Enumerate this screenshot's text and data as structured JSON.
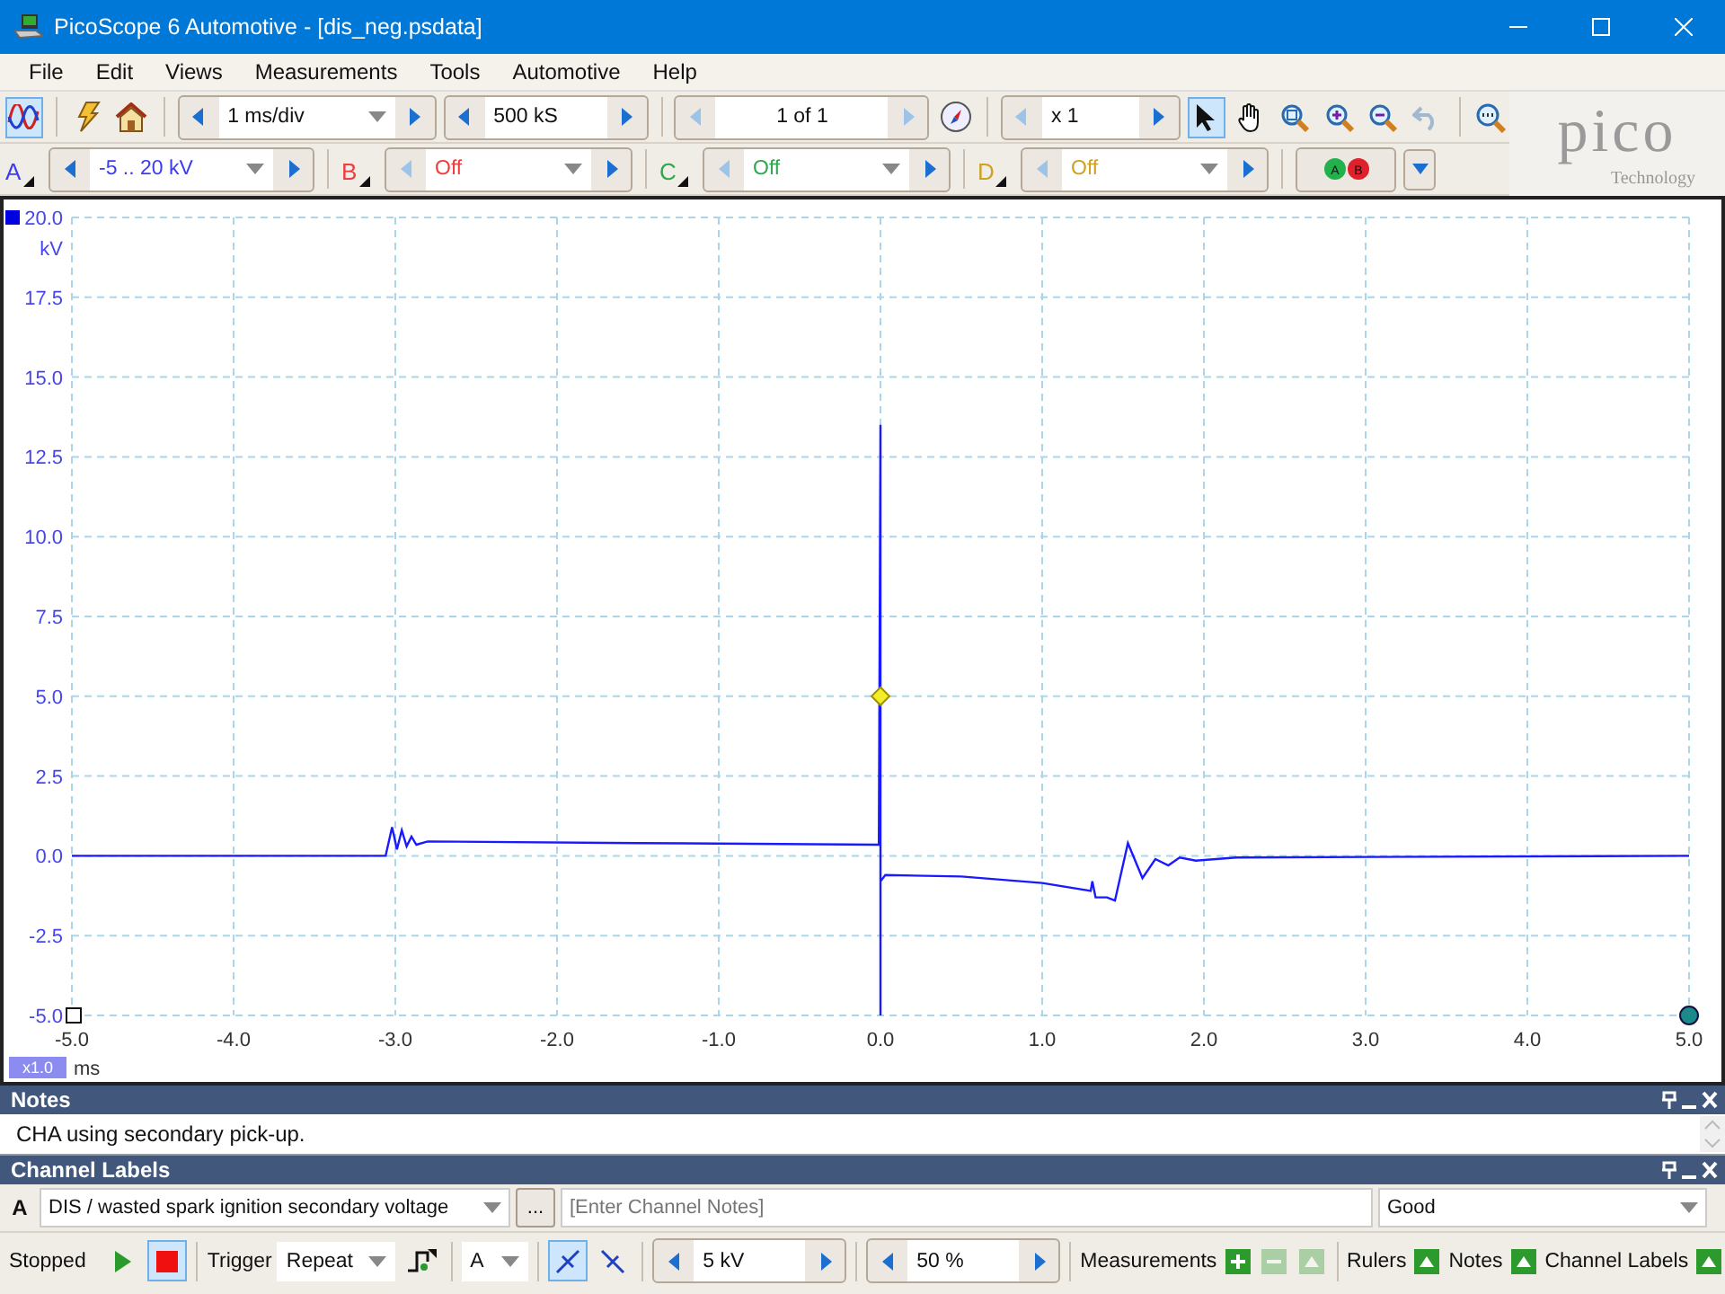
{
  "window": {
    "title": "PicoScope 6 Automotive - [dis_neg.psdata]"
  },
  "menu": [
    "File",
    "Edit",
    "Views",
    "Measurements",
    "Tools",
    "Automotive",
    "Help"
  ],
  "toolbar": {
    "timebase": "1 ms/div",
    "samples": "500 kS",
    "buffer": "1 of 1",
    "zoom": "x 1",
    "tools": [
      {
        "kind": "pointer",
        "selected": true,
        "disabled": false
      },
      {
        "kind": "hand",
        "selected": false,
        "disabled": false
      },
      {
        "kind": "zoom-box",
        "selected": false,
        "disabled": false
      },
      {
        "kind": "zoom-in",
        "selected": false,
        "disabled": false
      },
      {
        "kind": "zoom-out",
        "selected": false,
        "disabled": false
      },
      {
        "kind": "undo",
        "selected": false,
        "disabled": true
      }
    ]
  },
  "logo": {
    "name": "pico",
    "tagline": "Technology"
  },
  "channels": [
    {
      "letter": "A",
      "range": "-5 .. 20 kV",
      "color": "#3c3cf0",
      "enabled": true
    },
    {
      "letter": "B",
      "range": "Off",
      "color": "#f03c3c",
      "enabled": false
    },
    {
      "letter": "C",
      "range": "Off",
      "color": "#2fa84f",
      "enabled": false
    },
    {
      "letter": "D",
      "range": "Off",
      "color": "#d0a020",
      "enabled": false
    }
  ],
  "channel_dots": [
    {
      "label": "A",
      "color": "#22b14c"
    },
    {
      "label": "B",
      "color": "#e0202a"
    }
  ],
  "scope": {
    "zoom_badge": "x1.0",
    "chart_data": {
      "type": "line",
      "grid": true,
      "xlabel": "ms",
      "ylabel": "kV",
      "xlim": [
        -5,
        5
      ],
      "ylim": [
        -5,
        20
      ],
      "xticks": [
        {
          "value": -5,
          "label": "-5.0"
        },
        {
          "value": -4,
          "label": "-4.0"
        },
        {
          "value": -3,
          "label": "-3.0"
        },
        {
          "value": -2,
          "label": "-2.0"
        },
        {
          "value": -1,
          "label": "-1.0"
        },
        {
          "value": 0,
          "label": "0.0"
        },
        {
          "value": 1,
          "label": "1.0"
        },
        {
          "value": 2,
          "label": "2.0"
        },
        {
          "value": 3,
          "label": "3.0"
        },
        {
          "value": 4,
          "label": "4.0"
        },
        {
          "value": 5,
          "label": "5.0"
        }
      ],
      "yticks": [
        {
          "value": -5,
          "label": "-5.0"
        },
        {
          "value": -2.5,
          "label": "-2.5"
        },
        {
          "value": 0,
          "label": "0.0"
        },
        {
          "value": 2.5,
          "label": "2.5"
        },
        {
          "value": 5,
          "label": "5.0"
        },
        {
          "value": 7.5,
          "label": "7.5"
        },
        {
          "value": 10,
          "label": "10.0"
        },
        {
          "value": 12.5,
          "label": "12.5"
        },
        {
          "value": 15,
          "label": "15.0"
        },
        {
          "value": 17.5,
          "label": "17.5"
        },
        {
          "value": 20,
          "label": "20.0"
        }
      ],
      "x": [
        -5,
        -3.06,
        -3.02,
        -2.99,
        -2.96,
        -2.93,
        -2.9,
        -2.87,
        -2.8,
        -1.5,
        -0.01,
        0,
        0,
        0,
        0.03,
        0.5,
        1.0,
        1.3,
        1.31,
        1.33,
        1.4,
        1.45,
        1.53,
        1.62,
        1.7,
        1.78,
        1.85,
        1.95,
        2.2,
        5
      ],
      "series": [
        {
          "color": "#1a1aff",
          "values": [
            0,
            0,
            0.9,
            0.2,
            0.8,
            0.3,
            0.6,
            0.35,
            0.45,
            0.4,
            0.35,
            13.5,
            -5,
            -0.8,
            -0.6,
            -0.65,
            -0.85,
            -1.1,
            -0.8,
            -1.3,
            -1.3,
            -1.4,
            0.4,
            -0.7,
            -0.1,
            -0.3,
            -0.05,
            -0.15,
            -0.05,
            0
          ]
        }
      ]
    }
  },
  "notes": {
    "title": "Notes",
    "text": "CHA using secondary pick-up."
  },
  "channel_labels": {
    "title": "Channel Labels",
    "channel": "A",
    "label": "DIS / wasted spark ignition secondary voltage",
    "more": "...",
    "notes_placeholder": "[Enter Channel Notes]",
    "quality": "Good"
  },
  "status_bar": {
    "state": "Stopped",
    "running": false,
    "trigger_label": "Trigger",
    "trigger_mode": "Repeat",
    "trigger_channel": "A",
    "edges": [
      {
        "kind": "rising",
        "selected": true
      },
      {
        "kind": "falling",
        "selected": false
      }
    ],
    "threshold": "5 kV",
    "pretrigger": "50 %",
    "measurements": {
      "label": "Measurements",
      "buttons": [
        {
          "kind": "add",
          "disabled": false
        },
        {
          "kind": "remove",
          "disabled": true
        },
        {
          "kind": "edit",
          "disabled": true
        }
      ]
    },
    "toggles": [
      {
        "label": "Rulers"
      },
      {
        "label": "Notes"
      },
      {
        "label": "Channel Labels"
      }
    ]
  }
}
